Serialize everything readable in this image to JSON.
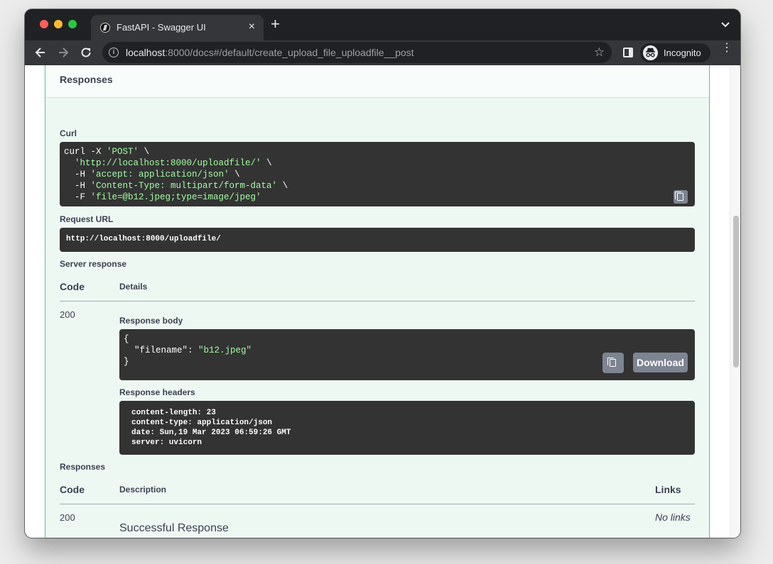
{
  "browser": {
    "tab_title": "FastAPI - Swagger UI",
    "tab_close": "×",
    "new_tab": "+",
    "url_host": "localhost",
    "url_rest": ":8000/docs#/default/create_upload_file_uploadfile__post",
    "incognito_label": "Incognito",
    "menu": "⋮",
    "star": "☆",
    "info": "i"
  },
  "responses_section": {
    "title": "Responses",
    "curl_label": "Curl",
    "curl_lines": [
      {
        "pre": "curl -X ",
        "str": "'POST'",
        "post": " \\"
      },
      {
        "pre": "  ",
        "str": "'http://localhost:8000/uploadfile/'",
        "post": " \\"
      },
      {
        "pre": "  -H ",
        "str": "'accept: application/json'",
        "post": " \\"
      },
      {
        "pre": "  -H ",
        "str": "'Content-Type: multipart/form-data'",
        "post": " \\"
      },
      {
        "pre": "  -F ",
        "str": "'file=@b12.jpeg;type=image/jpeg'",
        "post": ""
      }
    ],
    "request_url_label": "Request URL",
    "request_url": "http://localhost:8000/uploadfile/",
    "server_response_label": "Server response",
    "code_header": "Code",
    "details_header": "Details",
    "status_code": "200",
    "response_body_label": "Response body",
    "response_body": {
      "open": "{",
      "key": "\"filename\"",
      "colon": ": ",
      "value": "\"b12.jpeg\"",
      "close": "}"
    },
    "download_label": "Download",
    "response_headers_label": "Response headers",
    "response_headers": [
      "content-length: 23",
      "content-type: application/json",
      "date: Sun,19 Mar 2023 06:59:26 GMT",
      "server: uvicorn"
    ]
  },
  "responses_table": {
    "title": "Responses",
    "code_header": "Code",
    "description_header": "Description",
    "links_header": "Links",
    "rows": [
      {
        "code": "200",
        "description": "Successful Response",
        "links": "No links"
      }
    ]
  }
}
